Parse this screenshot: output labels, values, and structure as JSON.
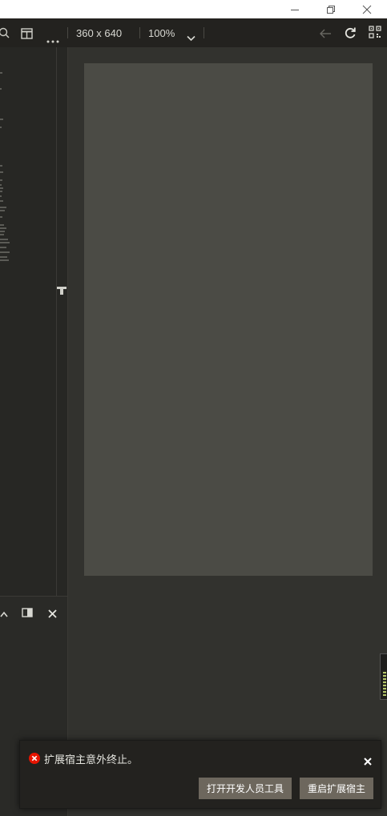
{
  "toolbar": {
    "resolution": "360 x 640",
    "zoom": "100%"
  },
  "notification": {
    "message": "扩展宿主意外终止。",
    "open_devtools_label": "打开开发人员工具",
    "restart_host_label": "重启扩展宿主"
  },
  "colors": {
    "error": "#e51400",
    "button": "#6d675d",
    "device_bg": "#4b4b45"
  }
}
